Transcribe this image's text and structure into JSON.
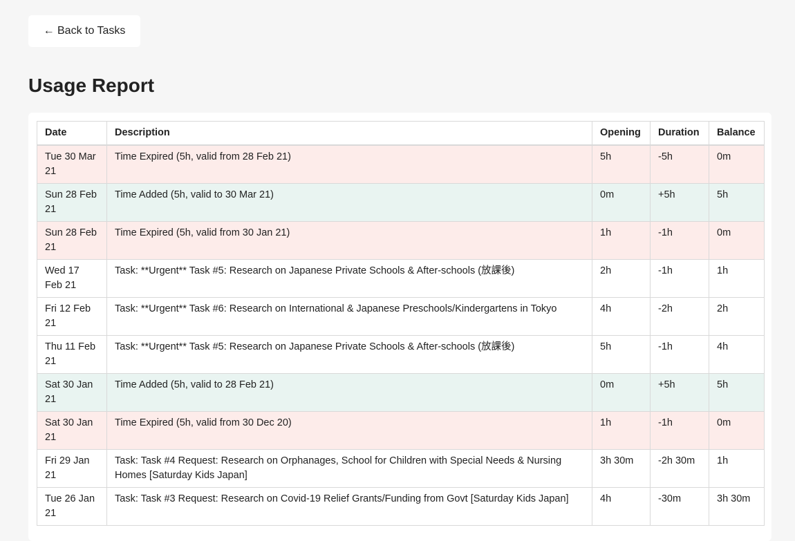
{
  "nav": {
    "back_label": "← Back to Tasks"
  },
  "page": {
    "title": "Usage Report"
  },
  "colors": {
    "expired_row": "#fdecea",
    "added_row": "#e9f4f1",
    "task_row": "#ffffff",
    "background": "#f6f6f6"
  },
  "table": {
    "headers": {
      "date": "Date",
      "description": "Description",
      "opening": "Opening",
      "duration": "Duration",
      "balance": "Balance"
    },
    "rows": [
      {
        "type": "expired",
        "date": "Tue 30 Mar 21",
        "description": "Time Expired (5h, valid from 28 Feb 21)",
        "opening": "5h",
        "duration": "-5h",
        "balance": "0m"
      },
      {
        "type": "added",
        "date": "Sun 28 Feb 21",
        "description": "Time Added (5h, valid to 30 Mar 21)",
        "opening": "0m",
        "duration": "+5h",
        "balance": "5h"
      },
      {
        "type": "expired",
        "date": "Sun 28 Feb 21",
        "description": "Time Expired (5h, valid from 30 Jan 21)",
        "opening": "1h",
        "duration": "-1h",
        "balance": "0m"
      },
      {
        "type": "task",
        "date": "Wed 17 Feb 21",
        "description": "Task: **Urgent** Task #5: Research on Japanese Private Schools & After-schools (放課後)",
        "opening": "2h",
        "duration": "-1h",
        "balance": "1h"
      },
      {
        "type": "task",
        "date": "Fri 12 Feb 21",
        "description": "Task: **Urgent** Task #6: Research on International & Japanese Preschools/Kindergartens in Tokyo",
        "opening": "4h",
        "duration": "-2h",
        "balance": "2h"
      },
      {
        "type": "task",
        "date": "Thu 11 Feb 21",
        "description": "Task: **Urgent** Task #5: Research on Japanese Private Schools & After-schools (放課後)",
        "opening": "5h",
        "duration": "-1h",
        "balance": "4h"
      },
      {
        "type": "added",
        "date": "Sat 30 Jan 21",
        "description": "Time Added (5h, valid to 28 Feb 21)",
        "opening": "0m",
        "duration": "+5h",
        "balance": "5h"
      },
      {
        "type": "expired",
        "date": "Sat 30 Jan 21",
        "description": "Time Expired (5h, valid from 30 Dec 20)",
        "opening": "1h",
        "duration": "-1h",
        "balance": "0m"
      },
      {
        "type": "task",
        "date": "Fri 29 Jan 21",
        "description": "Task: Task #4 Request: Research on Orphanages, School for Children with Special Needs & Nursing Homes [Saturday Kids Japan]",
        "opening": "3h 30m",
        "duration": "-2h 30m",
        "balance": "1h"
      },
      {
        "type": "task",
        "date": "Tue 26 Jan 21",
        "description": "Task: Task #3 Request: Research on Covid-19 Relief Grants/Funding from Govt [Saturday Kids Japan]",
        "opening": "4h",
        "duration": "-30m",
        "balance": "3h 30m"
      }
    ]
  }
}
